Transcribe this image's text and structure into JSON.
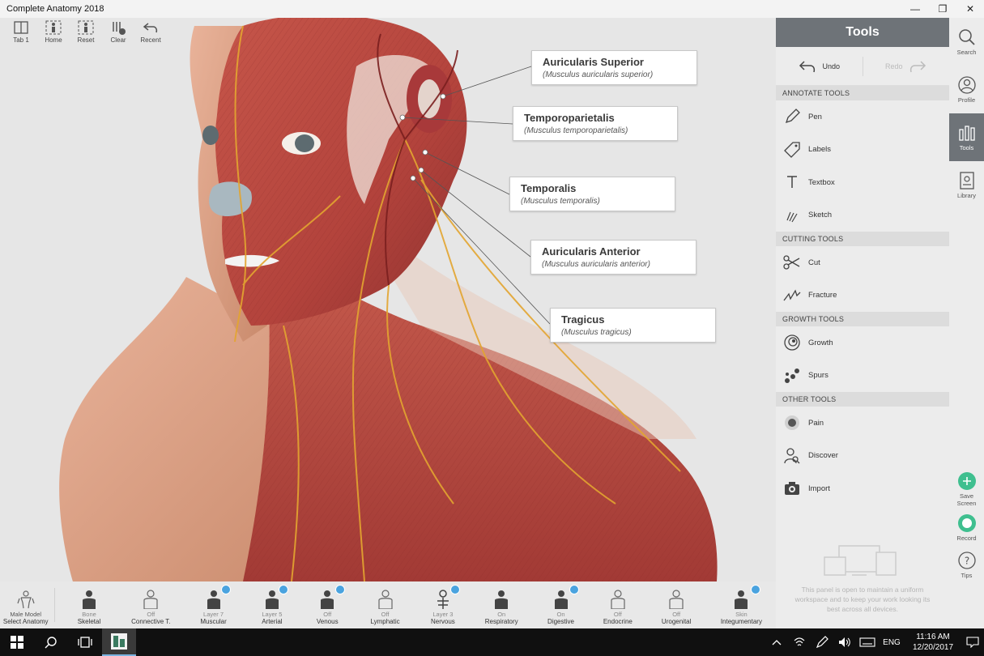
{
  "window": {
    "title": "Complete Anatomy 2018",
    "minimize": "—",
    "restore": "❐",
    "close": "✕"
  },
  "toolbar": {
    "items": [
      {
        "label": "Tab 1"
      },
      {
        "label": "Home"
      },
      {
        "label": "Reset"
      },
      {
        "label": "Clear"
      },
      {
        "label": "Recent"
      }
    ]
  },
  "callouts": [
    {
      "name": "Auricularis Superior",
      "latin": "(Musculus auricularis superior)"
    },
    {
      "name": "Temporoparietalis",
      "latin": "(Musculus temporoparietalis)"
    },
    {
      "name": "Temporalis",
      "latin": "(Musculus temporalis)"
    },
    {
      "name": "Auricularis Anterior",
      "latin": "(Musculus auricularis anterior)"
    },
    {
      "name": "Tragicus",
      "latin": "(Musculus tragicus)"
    }
  ],
  "tools_panel": {
    "title": "Tools",
    "undo": "Undo",
    "redo": "Redo",
    "sections": [
      {
        "header": "ANNOTATE TOOLS",
        "items": [
          {
            "label": "Pen",
            "icon": "pen-icon"
          },
          {
            "label": "Labels",
            "icon": "tag-icon"
          },
          {
            "label": "Textbox",
            "icon": "text-icon"
          },
          {
            "label": "Sketch",
            "icon": "sketch-icon"
          }
        ]
      },
      {
        "header": "CUTTING TOOLS",
        "items": [
          {
            "label": "Cut",
            "icon": "scissors-icon"
          },
          {
            "label": "Fracture",
            "icon": "fracture-icon"
          }
        ]
      },
      {
        "header": "GROWTH TOOLS",
        "items": [
          {
            "label": "Growth",
            "icon": "growth-icon"
          },
          {
            "label": "Spurs",
            "icon": "spurs-icon"
          }
        ]
      },
      {
        "header": "OTHER TOOLS",
        "items": [
          {
            "label": "Pain",
            "icon": "pain-icon"
          },
          {
            "label": "Discover",
            "icon": "discover-icon"
          },
          {
            "label": "Import",
            "icon": "camera-icon"
          }
        ]
      }
    ],
    "note": "This panel is open to maintain a uniform workspace and to keep your work looking its best across all devices."
  },
  "right_rail": {
    "search": "Search",
    "profile": "Profile",
    "tools": "Tools",
    "library": "Library",
    "save_screen": "Save Screen",
    "record": "Record",
    "tips": "Tips"
  },
  "systems": {
    "model": {
      "line1": "Male Model",
      "line2": "Select Anatomy"
    },
    "items": [
      {
        "state": "Bone",
        "name": "Skeletal",
        "badge": false
      },
      {
        "state": "Off",
        "name": "Connective T.",
        "badge": false
      },
      {
        "state": "Layer 7",
        "name": "Muscular",
        "badge": true
      },
      {
        "state": "Layer 5",
        "name": "Arterial",
        "badge": true
      },
      {
        "state": "Off",
        "name": "Venous",
        "badge": true
      },
      {
        "state": "Off",
        "name": "Lymphatic",
        "badge": false
      },
      {
        "state": "Layer 3",
        "name": "Nervous",
        "badge": true
      },
      {
        "state": "On",
        "name": "Respiratory",
        "badge": false
      },
      {
        "state": "On",
        "name": "Digestive",
        "badge": true
      },
      {
        "state": "Off",
        "name": "Endocrine",
        "badge": false
      },
      {
        "state": "Off",
        "name": "Urogenital",
        "badge": false
      },
      {
        "state": "Skin",
        "name": "Integumentary",
        "badge": true
      }
    ]
  },
  "taskbar": {
    "language": "ENG",
    "time": "11:16 AM",
    "date": "12/20/2017"
  },
  "colors": {
    "accent": "#6e7378",
    "badge": "#4aa3df",
    "green": "#3fbf8f",
    "muscle": "#b5473f"
  }
}
